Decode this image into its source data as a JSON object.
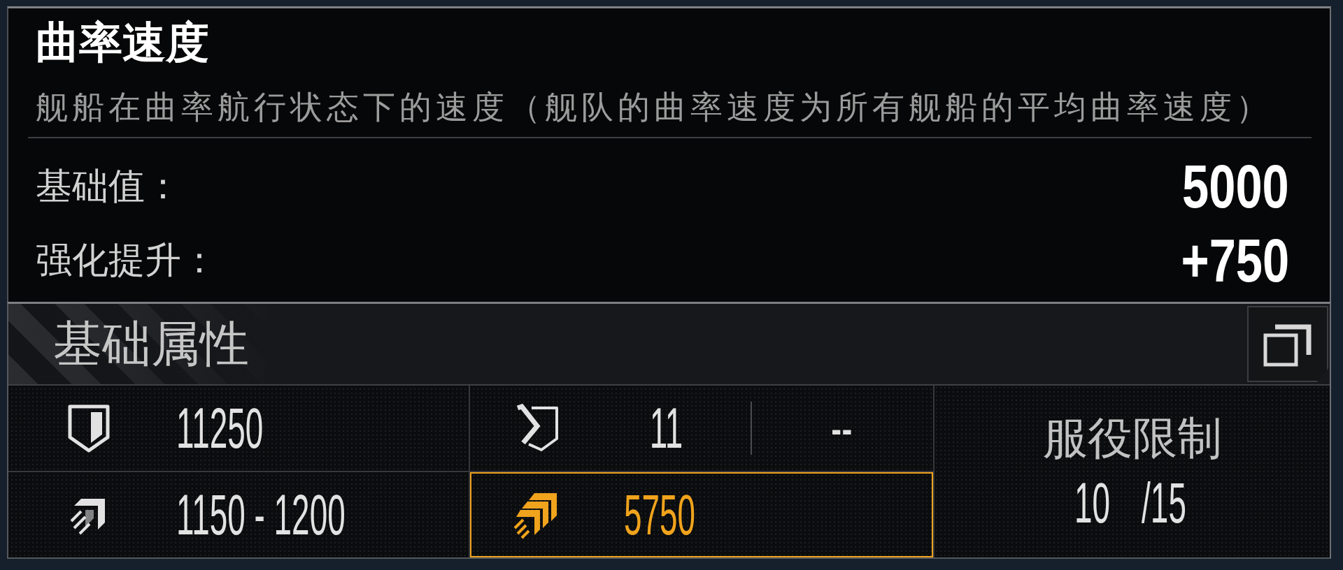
{
  "tooltip": {
    "title": "曲率速度",
    "description": "舰船在曲率航行状态下的速度（舰队的曲率速度为所有舰船的平均曲率速度）",
    "rows": [
      {
        "label": "基础值：",
        "value": "5000"
      },
      {
        "label": "强化提升：",
        "value": "+750"
      }
    ]
  },
  "panel": {
    "title": "基础属性",
    "stats": [
      {
        "kind": "single",
        "value": "11250",
        "selected": false
      },
      {
        "kind": "pair",
        "values": [
          "11",
          "--"
        ],
        "selected": false
      },
      {
        "kind": "single",
        "value": "1150 - 1200",
        "selected": false
      },
      {
        "kind": "single",
        "value": "5750",
        "selected": true
      }
    ],
    "service_limit": {
      "label": "服役限制",
      "current": "10",
      "max": "/15"
    }
  }
}
